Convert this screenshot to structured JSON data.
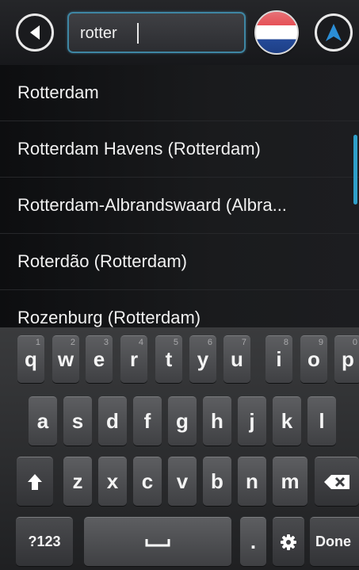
{
  "search": {
    "value": "rotter",
    "back_icon": "back-arrow-icon",
    "nav_icon": "navigation-arrow-icon",
    "country_flag_icon": "netherlands-flag-icon"
  },
  "results": [
    "Rotterdam",
    "Rotterdam Havens (Rotterdam)",
    "Rotterdam-Albrandswaard (Albra...",
    "Roterdão (Rotterdam)",
    "Rozenburg (Rotterdam)"
  ],
  "keyboard": {
    "row1": [
      {
        "label": "q",
        "hint": "1"
      },
      {
        "label": "w",
        "hint": "2"
      },
      {
        "label": "e",
        "hint": "3"
      },
      {
        "label": "r",
        "hint": "4"
      },
      {
        "label": "t",
        "hint": "5"
      },
      {
        "label": "y",
        "hint": "6"
      },
      {
        "label": "u",
        "hint": "7"
      },
      {
        "label": "i",
        "hint": "8"
      },
      {
        "label": "o",
        "hint": "9"
      },
      {
        "label": "p",
        "hint": "0"
      }
    ],
    "row2": [
      "a",
      "s",
      "d",
      "f",
      "g",
      "h",
      "j",
      "k",
      "l"
    ],
    "row3": [
      "z",
      "x",
      "c",
      "v",
      "b",
      "n",
      "m"
    ],
    "symbols_label": "?123",
    "period_label": ".",
    "done_label": "Done",
    "shift_icon": "shift-icon",
    "delete_icon": "backspace-icon",
    "space_icon": "space-icon",
    "settings_icon": "gear-icon"
  },
  "colors": {
    "accent": "#2f9fc9",
    "search_border": "#3e86a3",
    "nav_arrow": "#2b8ed6"
  }
}
